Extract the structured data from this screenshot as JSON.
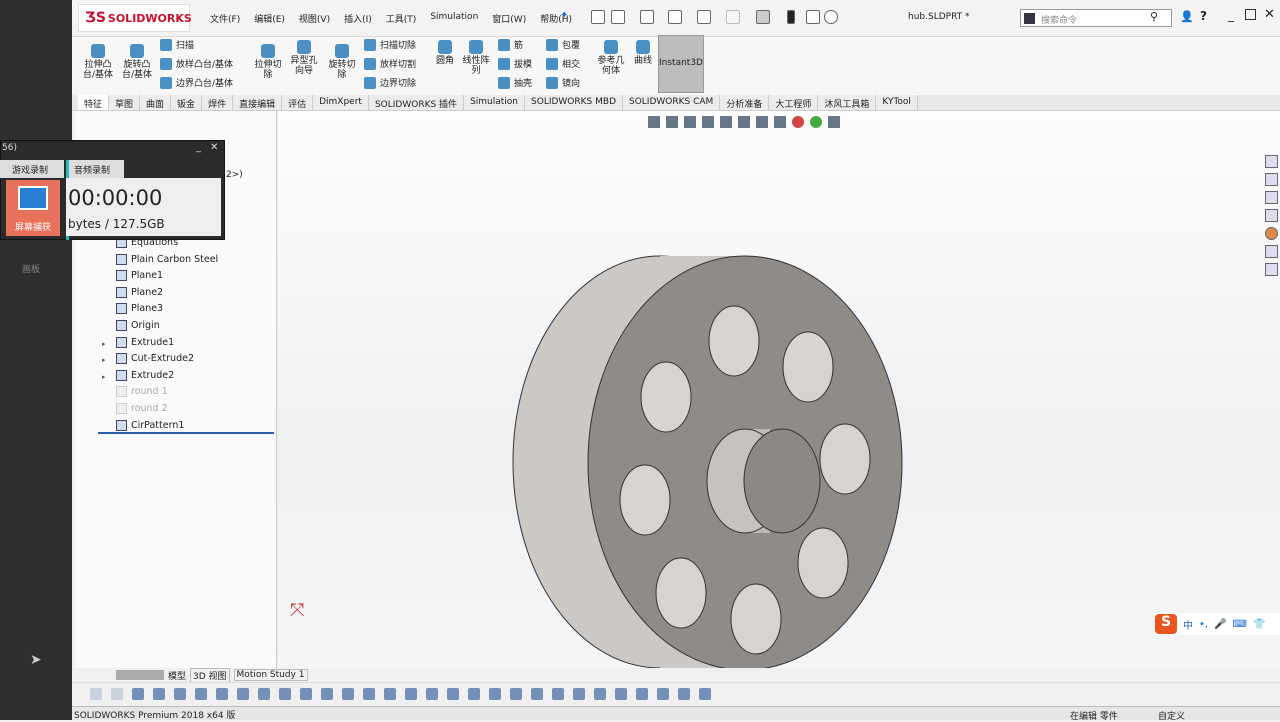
{
  "app": {
    "logo": "SOLIDWORKS",
    "title": "hub.SLDPRT *",
    "search_placeholder": "搜索命令"
  },
  "menu": [
    "文件(F)",
    "编辑(E)",
    "视图(V)",
    "插入(I)",
    "工具(T)",
    "Simulation",
    "窗口(W)",
    "帮助(H)"
  ],
  "ribbon": {
    "large": [
      "拉伸凸台/基体",
      "旋转凸台/基体",
      "拉伸切除",
      "异型孔向导",
      "旋转切除",
      "圆角",
      "线性阵列",
      "参考几何体",
      "曲线",
      "Instant3D"
    ],
    "small": [
      "扫描",
      "放样凸台/基体",
      "边界凸台/基体",
      "扫描切除",
      "放样切割",
      "边界切除",
      "筋",
      "拔模",
      "抽壳",
      "包覆",
      "相交",
      "镜向"
    ]
  },
  "tabs": [
    "特征",
    "草图",
    "曲面",
    "钣金",
    "焊件",
    "直接编辑",
    "评估",
    "DimXpert",
    "SOLIDWORKS 插件",
    "Simulation",
    "SOLIDWORKS MBD",
    "SOLIDWORKS CAM",
    "分析准备",
    "大工程师",
    "沐风工具箱",
    "KYTool"
  ],
  "tree": {
    "partial": "2>)",
    "items": [
      {
        "label": "Equations",
        "dim": false,
        "expand": false
      },
      {
        "label": "Plain Carbon Steel",
        "dim": false,
        "expand": false
      },
      {
        "label": "Plane1",
        "dim": false,
        "expand": false
      },
      {
        "label": "Plane2",
        "dim": false,
        "expand": false
      },
      {
        "label": "Plane3",
        "dim": false,
        "expand": false
      },
      {
        "label": "Origin",
        "dim": false,
        "expand": false
      },
      {
        "label": "Extrude1",
        "dim": false,
        "expand": true
      },
      {
        "label": "Cut-Extrude2",
        "dim": false,
        "expand": true
      },
      {
        "label": "Extrude2",
        "dim": false,
        "expand": true
      },
      {
        "label": "round 1",
        "dim": true,
        "expand": false
      },
      {
        "label": "round 2",
        "dim": true,
        "expand": false
      },
      {
        "label": "CirPattern1",
        "dim": false,
        "expand": false
      }
    ]
  },
  "recorder": {
    "title": "56)",
    "tab1": "游戏录制",
    "tab2": "音频录制",
    "capture": "屏幕捕获",
    "time": "00:00:00",
    "storage": "bytes / 127.5GB",
    "side": "画板"
  },
  "bottom_tabs": [
    "模型",
    "3D 视图",
    "Motion Study 1"
  ],
  "status": {
    "left": "SOLIDWORKS Premium 2018 x64 版",
    "editing": "在编辑 零件",
    "custom": "自定义"
  },
  "ime": {
    "logo": "S",
    "lang": "中"
  },
  "colors": {
    "face": "#8e8a87",
    "side": "#c9c6c3",
    "accent": "#c8102e"
  }
}
